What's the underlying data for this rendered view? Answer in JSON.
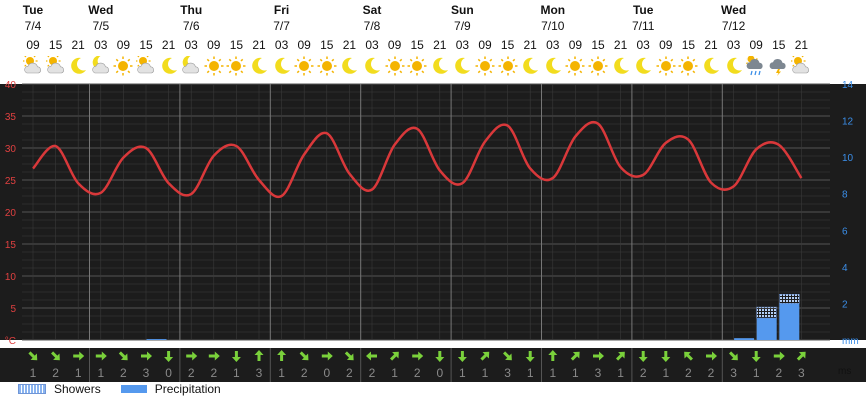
{
  "chart_data": {
    "type": "line",
    "title": "",
    "days": [
      {
        "name": "Tue",
        "date": "7/4"
      },
      {
        "name": "Wed",
        "date": "7/5"
      },
      {
        "name": "Thu",
        "date": "7/6"
      },
      {
        "name": "Fri",
        "date": "7/7"
      },
      {
        "name": "Sat",
        "date": "7/8"
      },
      {
        "name": "Sun",
        "date": "7/9"
      },
      {
        "name": "Mon",
        "date": "7/10"
      },
      {
        "name": "Tue",
        "date": "7/11"
      },
      {
        "name": "Wed",
        "date": "7/12"
      }
    ],
    "hours": [
      "09",
      "15",
      "21",
      "03",
      "09",
      "15",
      "21",
      "03",
      "09",
      "15",
      "21",
      "03",
      "09",
      "15",
      "21",
      "03",
      "09",
      "15",
      "21",
      "03",
      "09",
      "15",
      "21",
      "03",
      "09",
      "15",
      "21",
      "03",
      "09",
      "15",
      "21",
      "03",
      "09",
      "15",
      "21"
    ],
    "weather_icons": [
      "sun-cloud",
      "sun-cloud",
      "moon",
      "moon-cloud",
      "sun",
      "sun-cloud",
      "moon",
      "moon-cloud",
      "sun",
      "sun",
      "moon",
      "moon",
      "sun",
      "sun",
      "moon",
      "moon",
      "sun",
      "sun",
      "moon",
      "moon",
      "sun",
      "sun",
      "moon",
      "moon",
      "sun",
      "sun",
      "moon",
      "moon",
      "sun",
      "sun",
      "moon",
      "moon",
      "rain-cloud",
      "thunder-cloud",
      "sun-cloud"
    ],
    "series": [
      {
        "name": "Temperature",
        "unit": "°C",
        "color": "#d9383a",
        "values": [
          26.8,
          30.3,
          24.5,
          23.0,
          28.5,
          30.0,
          24.5,
          22.8,
          28.8,
          30.3,
          25.0,
          22.5,
          29.0,
          32.3,
          26.0,
          23.5,
          30.5,
          33.0,
          26.5,
          24.5,
          31.0,
          33.5,
          26.8,
          25.3,
          31.8,
          33.8,
          27.0,
          25.8,
          30.8,
          31.3,
          24.6,
          24.0,
          29.8,
          30.5,
          25.3
        ]
      },
      {
        "name": "Showers",
        "unit": "mm",
        "color": "#8ab4f0",
        "values": [
          0,
          0,
          0,
          0,
          0,
          0,
          0,
          0,
          0,
          0,
          0,
          0,
          0,
          0,
          0,
          0,
          0,
          0,
          0,
          0,
          0,
          0,
          0,
          0,
          0,
          0,
          0,
          0,
          0,
          0,
          0,
          0,
          0.6,
          0.5,
          0
        ]
      },
      {
        "name": "Precipitation",
        "unit": "mm",
        "color": "#5599ee",
        "values": [
          0,
          0,
          0,
          0,
          0,
          0.05,
          0,
          0,
          0,
          0,
          0,
          0,
          0,
          0,
          0,
          0,
          0,
          0,
          0,
          0,
          0,
          0,
          0,
          0,
          0,
          0,
          0,
          0,
          0,
          0,
          0,
          0.1,
          1.2,
          2.0,
          0
        ]
      }
    ],
    "ylim_left": [
      0,
      40
    ],
    "yticks_left": [
      "°C",
      "5",
      "10",
      "15",
      "20",
      "25",
      "30",
      "35",
      "40"
    ],
    "ylim_right": [
      0,
      14
    ],
    "yticks_right": [
      "mm",
      "2",
      "4",
      "6",
      "8",
      "10",
      "12",
      "14"
    ],
    "wind_dirs": [
      "se",
      "se",
      "e",
      "e",
      "se",
      "e",
      "s",
      "e",
      "e",
      "s",
      "n",
      "n",
      "se",
      "e",
      "se",
      "w",
      "ne",
      "e",
      "s",
      "s",
      "ne",
      "se",
      "s",
      "n",
      "ne",
      "e",
      "ne",
      "s",
      "s",
      "nw",
      "e",
      "se",
      "s",
      "e",
      "ne"
    ],
    "wind_speeds": [
      "1",
      "2",
      "1",
      "1",
      "2",
      "3",
      "0",
      "2",
      "2",
      "1",
      "3",
      "1",
      "2",
      "0",
      "2",
      "2",
      "1",
      "2",
      "0",
      "1",
      "1",
      "3",
      "1",
      "1",
      "1",
      "3",
      "1",
      "2",
      "1",
      "2",
      "2",
      "3",
      "1",
      "2",
      "3"
    ],
    "wind_unit": "ms",
    "grid": true,
    "legend": {
      "position": "bottom-left",
      "items": [
        "Showers",
        "Precipitation"
      ]
    }
  }
}
